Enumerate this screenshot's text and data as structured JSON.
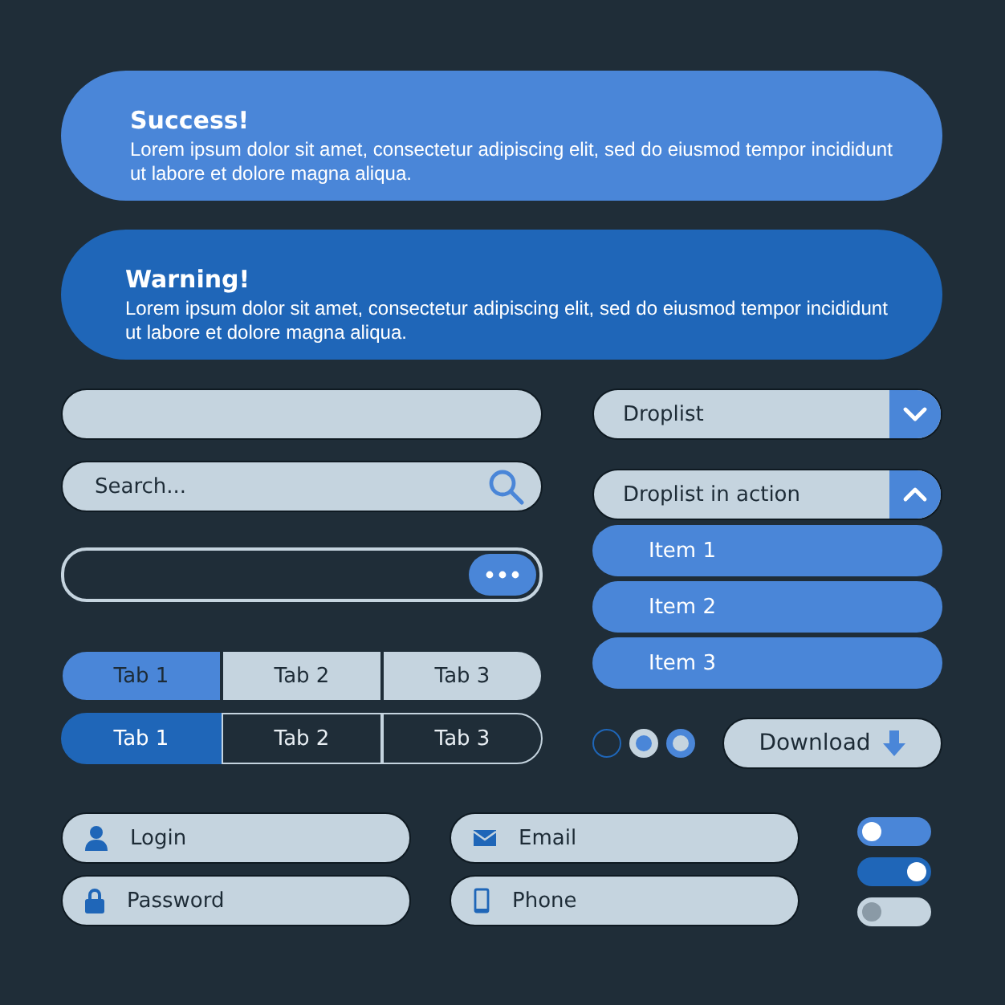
{
  "alerts": [
    {
      "kind": "success",
      "title": "Success!",
      "text": "Lorem ipsum dolor sit amet, consectetur adipiscing elit, sed do eiusmod tempor incididunt ut labore et dolore magna aliqua."
    },
    {
      "kind": "warning",
      "title": "Warning!",
      "text": "Lorem ipsum dolor sit amet, consectetur adipiscing elit, sed do eiusmod tempor incididunt ut labore et dolore magna aliqua."
    }
  ],
  "search": {
    "placeholder": "Search..."
  },
  "tab_groups": [
    {
      "kind": "light",
      "tabs": [
        {
          "label": "Tab 1",
          "selected": true
        },
        {
          "label": "Tab 2",
          "selected": false
        },
        {
          "label": "Tab 3",
          "selected": false
        }
      ]
    },
    {
      "kind": "dark",
      "tabs": [
        {
          "label": "Tab 1",
          "selected": true
        },
        {
          "label": "Tab 2",
          "selected": false
        },
        {
          "label": "Tab 3",
          "selected": false
        }
      ]
    }
  ],
  "droplists": [
    {
      "label": "Droplist",
      "expanded": false
    },
    {
      "label": "Droplist in action",
      "expanded": true,
      "items": [
        "Item 1",
        "Item 2",
        "Item 3"
      ]
    }
  ],
  "radios": [
    {
      "kind": "outline"
    },
    {
      "kind": "light"
    },
    {
      "kind": "filled"
    }
  ],
  "download": {
    "label": "Download"
  },
  "inputs": [
    {
      "kind": "login",
      "placeholder": "Login"
    },
    {
      "kind": "email",
      "placeholder": "Email"
    },
    {
      "kind": "password",
      "placeholder": "Password"
    },
    {
      "kind": "phone",
      "placeholder": "Phone"
    }
  ],
  "toggles": [
    {
      "on": false,
      "disabled": false
    },
    {
      "on": true,
      "disabled": false
    },
    {
      "on": false,
      "disabled": true
    }
  ]
}
